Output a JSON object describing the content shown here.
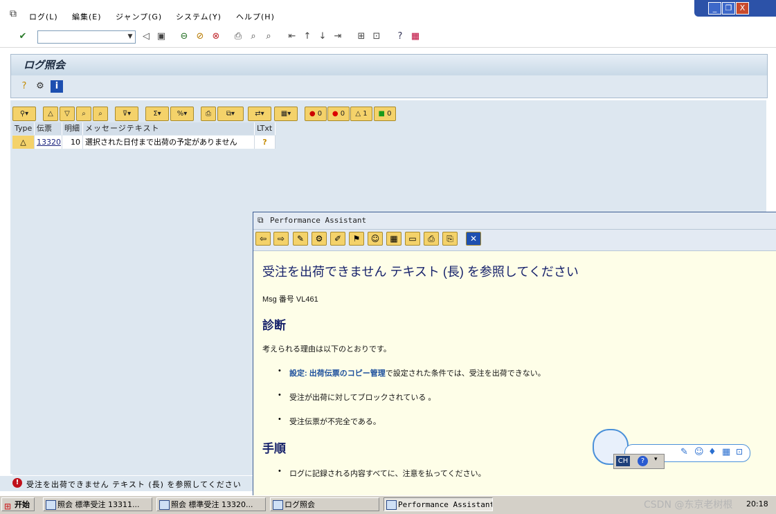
{
  "menu": [
    "ログ(L)",
    "編集(E)",
    "ジャンプ(G)",
    "システム(Y)",
    "ヘルプ(H)"
  ],
  "window_controls": {
    "minimize": "_",
    "restore": "❐",
    "close": "X"
  },
  "command_field": {
    "value": ""
  },
  "screen": {
    "title": "ログ照会"
  },
  "alv_toolbar": {
    "stop_count": "0",
    "error_count": "0",
    "warning_count": "1",
    "success_count": "0"
  },
  "grid": {
    "headers": [
      "Type",
      "伝票",
      "明細",
      "メッセージテキスト",
      "LTxt"
    ],
    "rows": [
      {
        "type_icon": "warning-triangle",
        "type": "△",
        "document": "13320",
        "item": "10",
        "message": "選択された日付まで出荷の予定がありません"
      }
    ]
  },
  "status_bar": {
    "message": "受注を出荷できません テキスト (長) を参照してください"
  },
  "popup": {
    "title": "Performance Assistant",
    "heading": "受注を出荷できません テキスト (長) を参照してください",
    "msg_no_label": "Msg 番号",
    "msg_no": "VL461",
    "diagnosis_heading": "診断",
    "diagnosis_intro": "考えられる理由は以下のとおりです。",
    "diagnosis_items": [
      {
        "link": "設定: 出荷伝票のコピー管理",
        "text": "で設定された条件では、受注を出荷できない。"
      },
      {
        "link": "",
        "text": "受注が出荷に対してブロックされている 。"
      },
      {
        "link": "",
        "text": "受注伝票が不完全である。"
      }
    ],
    "procedure_heading": "手順",
    "procedure_items": [
      "ログに記録される内容すべてに、注意を払ってください。"
    ]
  },
  "widget": {
    "lang": "CH"
  },
  "taskbar": {
    "start": "开始",
    "tasks": [
      "照会 標準受注 13311...",
      "照会 標準受注 13320...",
      "ログ照会",
      "Performance Assistant"
    ],
    "clock": "20:18",
    "watermark": "CSDN @东京老树根"
  },
  "colors": {
    "sap_blue": "#dde7f0",
    "popup_bg": "#fefee8",
    "heading_navy": "#17226b",
    "link_blue": "#1c4f9c",
    "taskbar": "#d4d0c8"
  }
}
